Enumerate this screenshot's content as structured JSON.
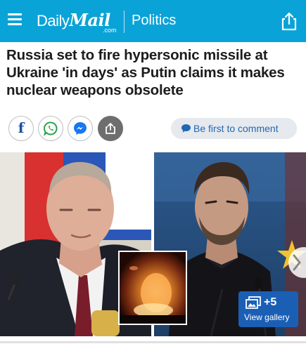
{
  "header": {
    "brand_daily": "Daily",
    "brand_mail": "Mail",
    "brand_com": ".com",
    "section": "Politics",
    "background_color": "#0aa3d8"
  },
  "article": {
    "headline": "Russia set to fire hypersonic missile at Ukraine 'in days' as Putin claims it makes nuclear weapons obsolete"
  },
  "share": {
    "facebook_letter": "f",
    "icons": [
      "facebook-icon",
      "whatsapp-icon",
      "messenger-icon",
      "share-icon"
    ],
    "comment_label": "Be first to comment",
    "comment_color": "#2068b5"
  },
  "gallery": {
    "count_label": "+5",
    "view_label": "View gallery",
    "badge_color": "#1b5fb5"
  }
}
